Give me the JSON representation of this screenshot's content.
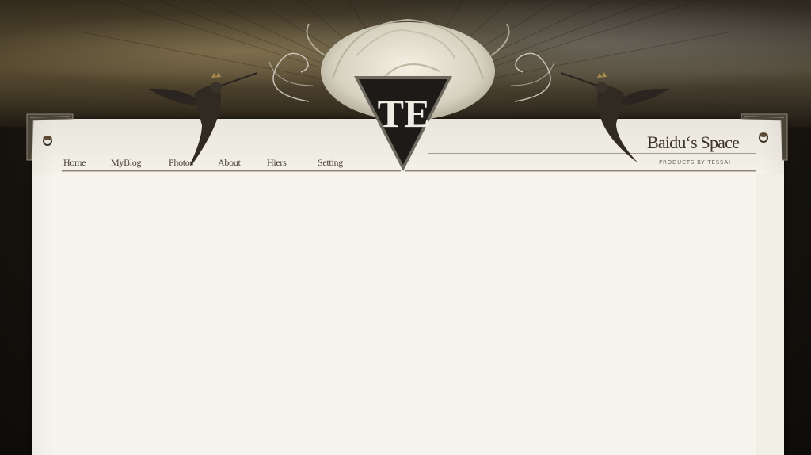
{
  "site": {
    "title": "Baidu‘s Space",
    "subtitle": "PRODUCTS BY TESSAI",
    "logo_text": "TE"
  },
  "nav": {
    "items": [
      {
        "label": "Home"
      },
      {
        "label": "MyBlog"
      },
      {
        "label": "Photos"
      },
      {
        "label": "About"
      },
      {
        "label": "Hiers"
      },
      {
        "label": "Setting"
      }
    ]
  },
  "colors": {
    "background": "#14110d",
    "paper": "#f7f4ed",
    "text": "#4a4236",
    "title": "#3b3228"
  },
  "icons": {
    "left_bird": "hummingbird-icon",
    "right_bird": "hummingbird-icon",
    "rose": "rose-icon",
    "logo": "triangle-logo-icon",
    "left_ornament": "swirl-ornament-icon",
    "right_ornament": "swirl-ornament-icon"
  }
}
